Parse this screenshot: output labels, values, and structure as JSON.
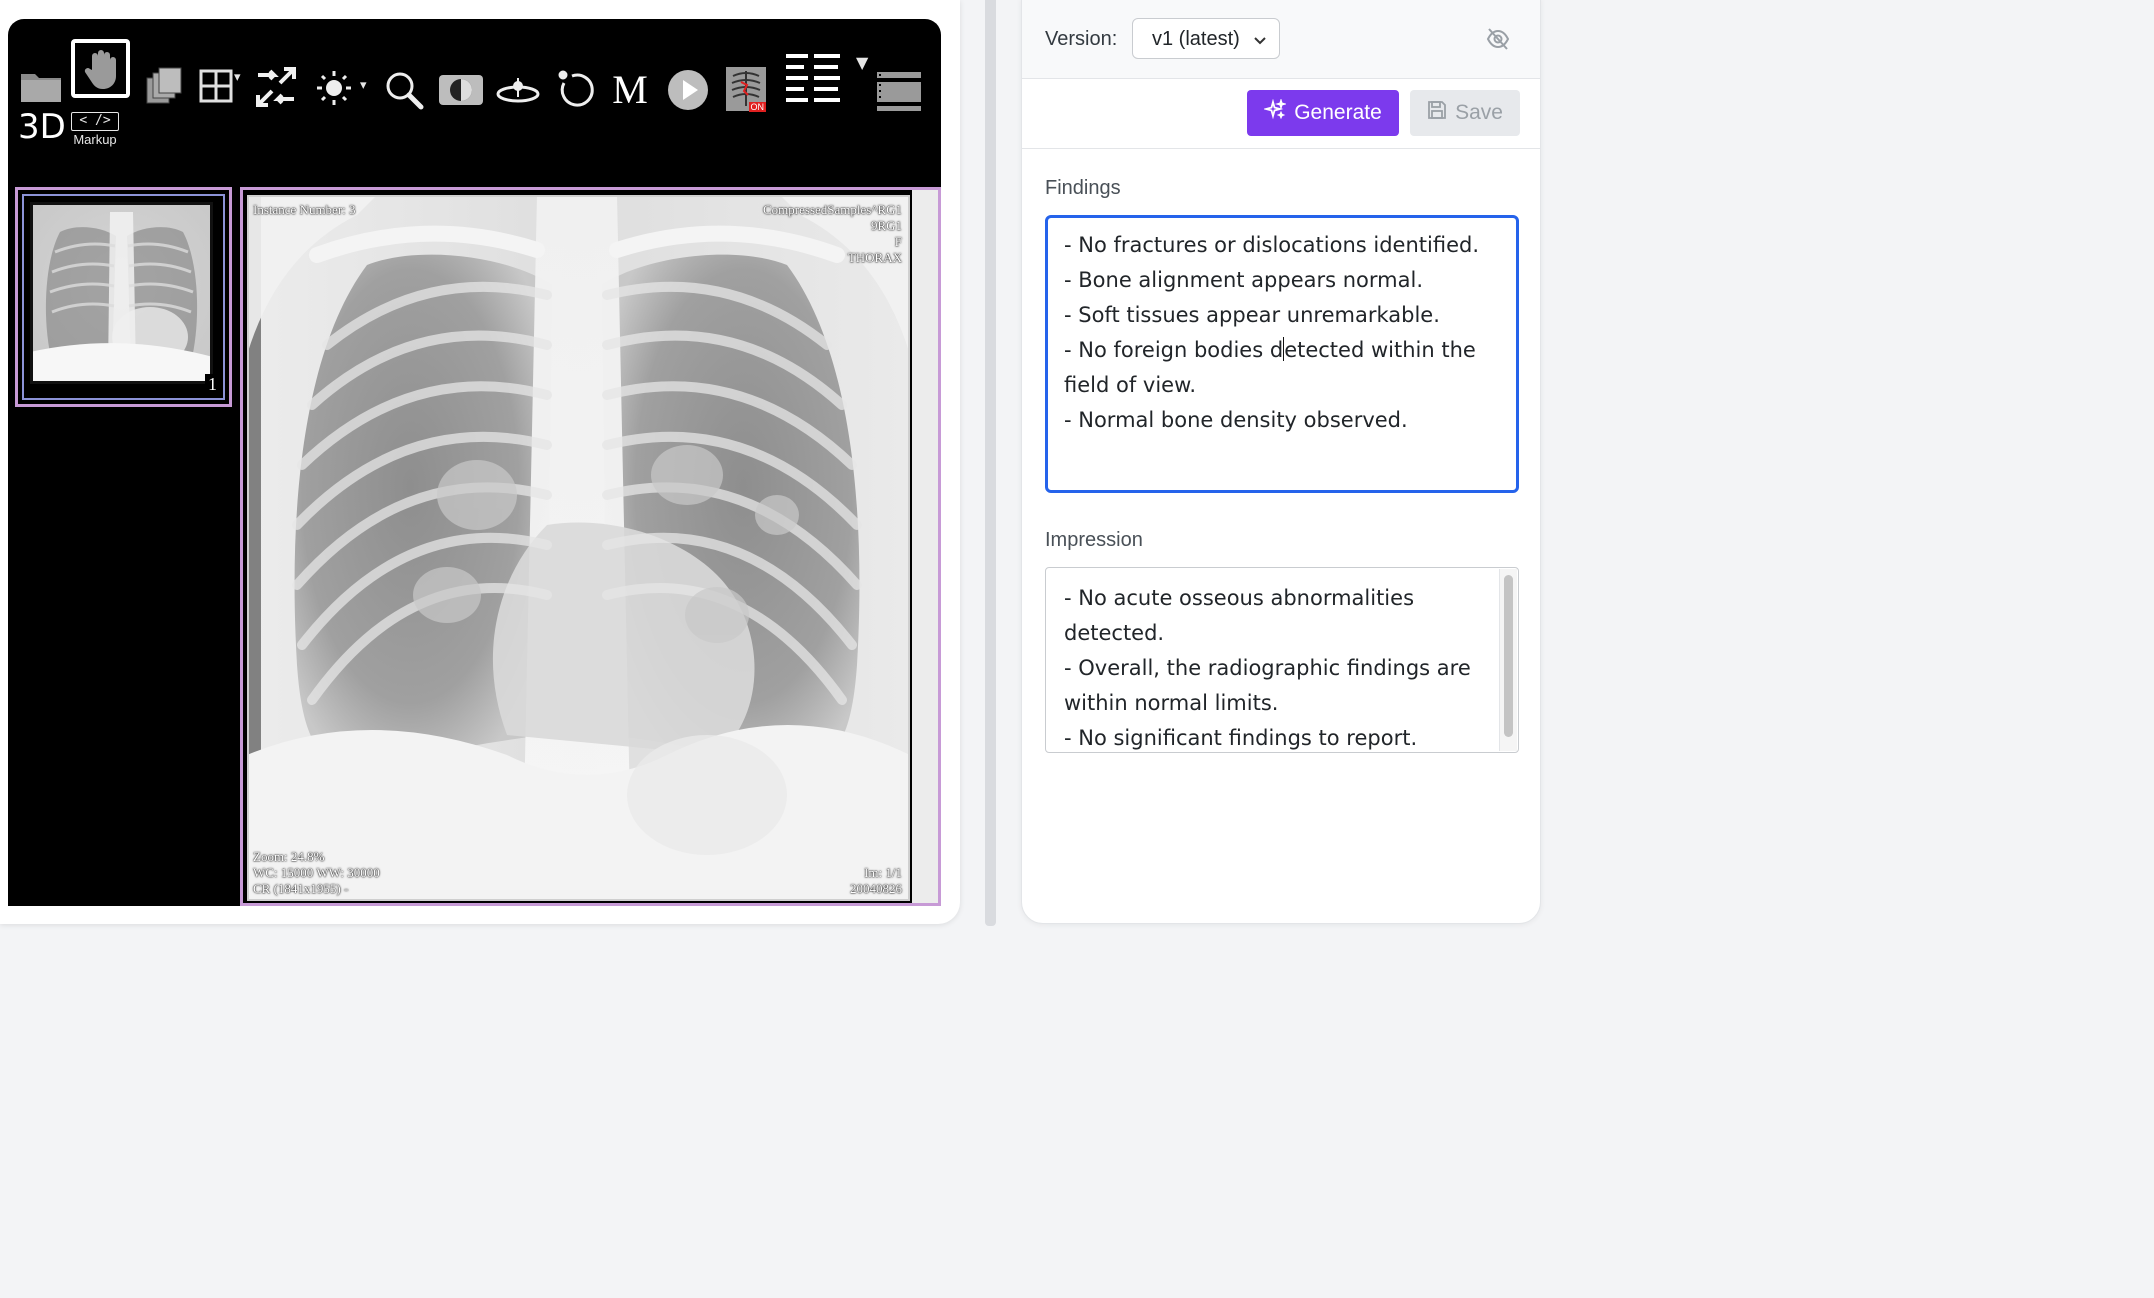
{
  "viewer": {
    "toolbar": {
      "tools": [
        "folder-icon",
        "pan-icon",
        "series-icon",
        "layout-icon",
        "fit-icon",
        "window-level-icon",
        "zoom-icon",
        "invert-icon",
        "rotate3d-icon",
        "reset-icon",
        "magnify-icon",
        "cine-play-icon",
        "ai-icon",
        "metadata-icon",
        "stack-icon"
      ],
      "m_label": "M",
      "ai_badge": "ON",
      "three_d_label": "3D",
      "markup_symbol": "< />",
      "markup_label": "Markup"
    },
    "thumbnail": {
      "number": "1"
    },
    "overlay": {
      "top_left": "Instance Number: 3",
      "top_right": [
        "CompressedSamples^RG1",
        "9RG1",
        "F",
        "THORAX"
      ],
      "bottom_left": [
        "Zoom: 24.8%",
        "WC: 15000 WW: 30000",
        "CR (1841x1955) -"
      ],
      "bottom_right": [
        "Im: 1/1",
        "20040826"
      ]
    }
  },
  "report": {
    "version_label": "Version:",
    "version_value": "v1 (latest)",
    "generate_label": "Generate",
    "save_label": "Save",
    "findings_label": "Findings",
    "findings_lines": [
      "- No fractures or dislocations identified.",
      "- Bone alignment appears normal.",
      "- Soft tissues appear unremarkable.",
      "- No foreign bodies d",
      "etected within the",
      "field of view.",
      "- Normal bone density observed."
    ],
    "impression_label": "Impression",
    "impression_lines": [
      "- No acute osseous abnormalities",
      "detected.",
      "- Overall, the radiographic findings are",
      "within normal limits.",
      "- No significant findings to report."
    ],
    "colors": {
      "accent": "#7c3aed",
      "focus": "#2563eb",
      "frame": "#c79ad6"
    }
  }
}
